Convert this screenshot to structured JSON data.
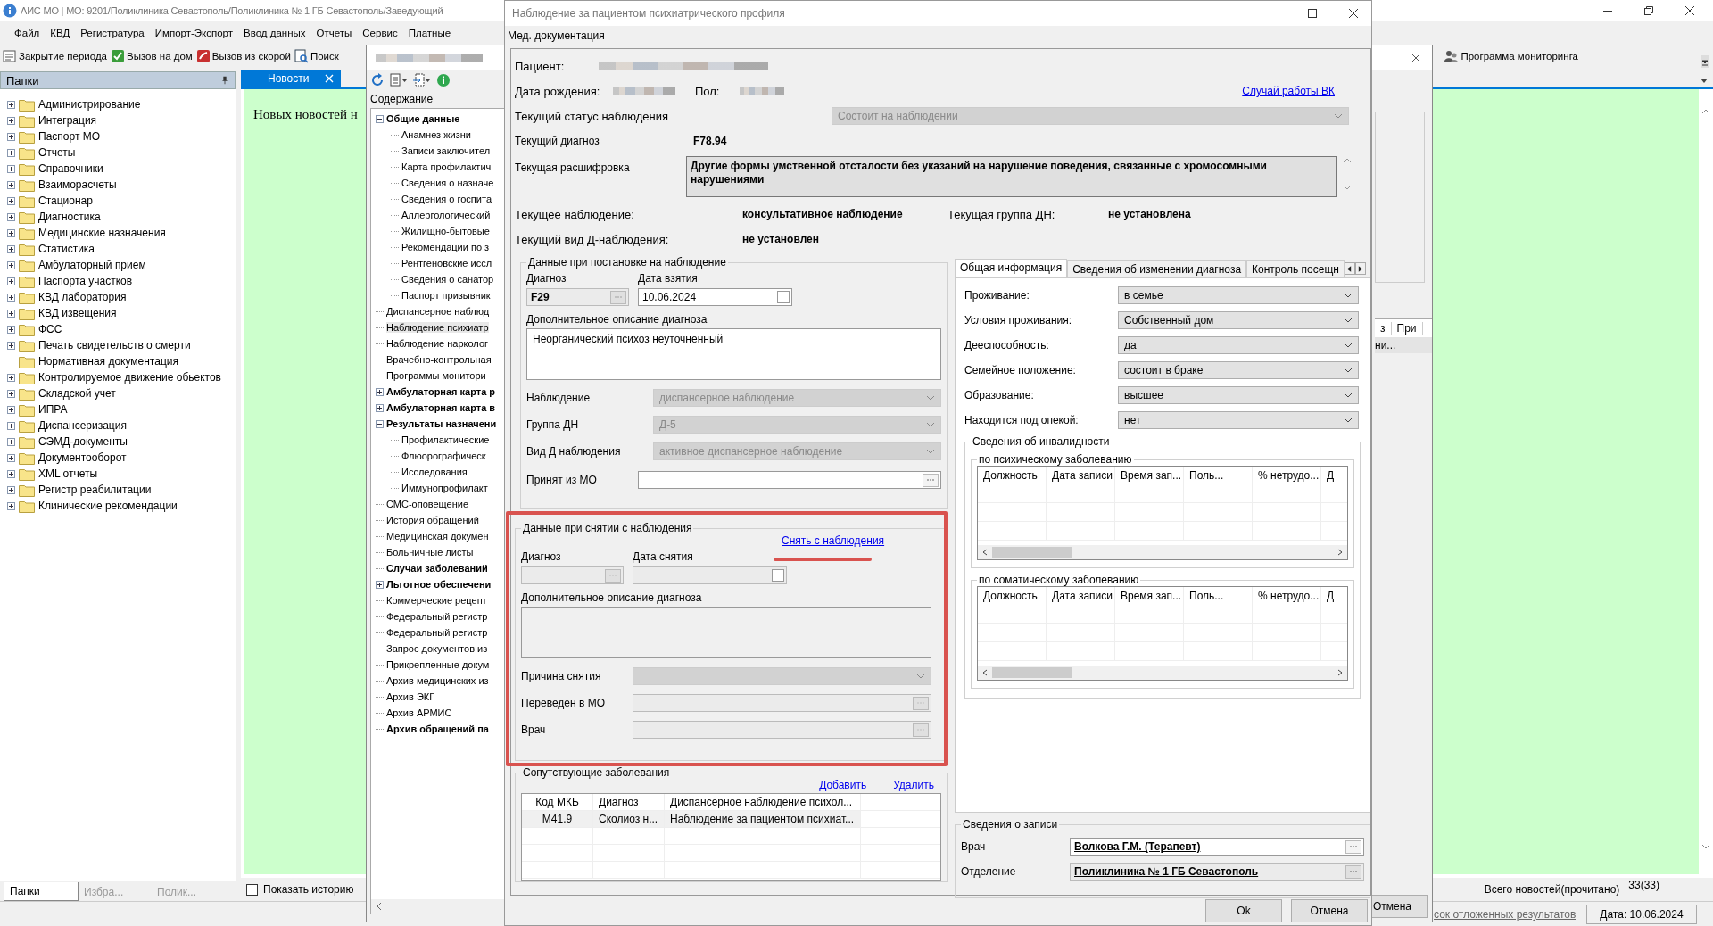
{
  "app": {
    "title": "АИС МО | МО: 9201/Поликлиника Севастополь/Поликлиника № 1 ГБ Севастополь/Заведующий",
    "menu": [
      "Файл",
      "КВД",
      "Регистратура",
      "Импорт-Экспорт",
      "Ввод данных",
      "Отчеты",
      "Сервис",
      "Платные"
    ],
    "toolbar": [
      {
        "label": "Закрытие периода",
        "kind": "period"
      },
      {
        "label": "Вызов на дом",
        "kind": "home"
      },
      {
        "label": "Вызов из скорой",
        "kind": "ambulance"
      },
      {
        "label": "Поиск",
        "kind": "search"
      }
    ],
    "toolbar_right": "Программа мониторинга",
    "folders_title": "Папки",
    "folders": [
      {
        "label": "Администрирование",
        "expandable": true
      },
      {
        "label": "Интеграция",
        "expandable": true
      },
      {
        "label": "Паспорт МО",
        "expandable": true
      },
      {
        "label": "Отчеты",
        "expandable": true
      },
      {
        "label": "Справочники",
        "expandable": true
      },
      {
        "label": "Взаиморасчеты",
        "expandable": true
      },
      {
        "label": "Стационар",
        "expandable": true
      },
      {
        "label": "Диагностика",
        "expandable": true
      },
      {
        "label": "Медицинские назначения",
        "expandable": true
      },
      {
        "label": "Статистика",
        "expandable": true
      },
      {
        "label": "Амбулаторный прием",
        "expandable": true
      },
      {
        "label": "Паспорта участков",
        "expandable": true
      },
      {
        "label": "КВД лаборатория",
        "expandable": true
      },
      {
        "label": "КВД извещения",
        "expandable": true
      },
      {
        "label": "ФСС",
        "expandable": true
      },
      {
        "label": "Печать свидетельств о смерти",
        "expandable": true
      },
      {
        "label": "Нормативная документация",
        "expandable": false
      },
      {
        "label": "Контролируемое движение обьектов",
        "expandable": true
      },
      {
        "label": "Складской учет",
        "expandable": true
      },
      {
        "label": "ИПРА",
        "expandable": true
      },
      {
        "label": "Диспансеризация",
        "expandable": true
      },
      {
        "label": "СЭМД-документы",
        "expandable": true
      },
      {
        "label": "Документооборот",
        "expandable": true
      },
      {
        "label": "XML отчеты",
        "expandable": true
      },
      {
        "label": "Регистр реабилитации",
        "expandable": true
      },
      {
        "label": "Клинические рекомендации",
        "expandable": true
      }
    ],
    "panel_tabs": [
      {
        "label": "Папки",
        "selected": true
      },
      {
        "label": "Избра...",
        "selected": false
      },
      {
        "label": "Полик...",
        "selected": false
      }
    ],
    "news_tab": "Новости",
    "news_text": "Новых новостей н",
    "show_history": {
      "label": "Показать историю",
      "checked": false
    },
    "news_total": "Всего новостей(прочитано)",
    "news_count": "33(33)",
    "status_link": "сок отложенных результатов",
    "status_date": "Дата: 10.06.2024"
  },
  "record_window": {
    "contents_label": "Содержание",
    "tree": [
      {
        "label": "Общие данные",
        "bold": true,
        "selected": false,
        "expanded": true,
        "children": [
          {
            "label": "Анамнез жизни",
            "bold": false,
            "selected": false
          },
          {
            "label": "Записи заключител",
            "bold": false,
            "selected": false
          },
          {
            "label": "Карта профилактич",
            "bold": false,
            "selected": false
          },
          {
            "label": "Сведения о назначе",
            "bold": false,
            "selected": false
          },
          {
            "label": "Сведения о госпита",
            "bold": false,
            "selected": false
          },
          {
            "label": "Аллергологический",
            "bold": false,
            "selected": false
          },
          {
            "label": "Жилищно-бытовые",
            "bold": false,
            "selected": false
          },
          {
            "label": "Рекомендации по з",
            "bold": false,
            "selected": false
          },
          {
            "label": "Рентгеновские иссл",
            "bold": false,
            "selected": false
          },
          {
            "label": "Сведения о санатор",
            "bold": false,
            "selected": false
          },
          {
            "label": "Паспорт призывник",
            "bold": false,
            "selected": false
          }
        ]
      },
      {
        "label": "Диспансерное наблюд",
        "bold": false,
        "selected": false
      },
      {
        "label": "Наблюдение психиатр",
        "bold": false,
        "selected": true
      },
      {
        "label": "Наблюдение нарколог",
        "bold": false,
        "selected": false
      },
      {
        "label": "Врачебно-контрольная",
        "bold": false,
        "selected": false
      },
      {
        "label": "Программы монитори",
        "bold": false,
        "selected": false
      },
      {
        "label": "Амбулаторная карта р",
        "bold": true,
        "selected": false,
        "expanded": false
      },
      {
        "label": "Амбулаторная карта в",
        "bold": true,
        "selected": false,
        "expanded": false
      },
      {
        "label": "Результаты назначени",
        "bold": true,
        "selected": false,
        "expanded": true,
        "children": [
          {
            "label": "Профилактические",
            "bold": false,
            "selected": false
          },
          {
            "label": "Флюорографическ",
            "bold": false,
            "selected": false
          },
          {
            "label": "Исследования",
            "bold": false,
            "selected": false
          },
          {
            "label": "Иммунопрофилакт",
            "bold": false,
            "selected": false
          }
        ]
      },
      {
        "label": "СМС-оповещение",
        "bold": false,
        "selected": false
      },
      {
        "label": "История обращений",
        "bold": false,
        "selected": false
      },
      {
        "label": "Медицинская докумен",
        "bold": false,
        "selected": false
      },
      {
        "label": "Больничные листы",
        "bold": false,
        "selected": false
      },
      {
        "label": "Случаи заболеваний",
        "bold": true,
        "selected": false
      },
      {
        "label": "Льготное обеспечени",
        "bold": true,
        "selected": false,
        "expanded": false
      },
      {
        "label": "Коммерческие рецепт",
        "bold": false,
        "selected": false
      },
      {
        "label": "Федеральный регистр",
        "bold": false,
        "selected": false
      },
      {
        "label": "Федеральный регистр",
        "bold": false,
        "selected": false
      },
      {
        "label": "Запрос документов из",
        "bold": false,
        "selected": false
      },
      {
        "label": "Прикрепленные докум",
        "bold": false,
        "selected": false
      },
      {
        "label": "Архив медицинских из",
        "bold": false,
        "selected": false
      },
      {
        "label": "Архив ЭКГ",
        "bold": false,
        "selected": false
      },
      {
        "label": "Архив АРМИС",
        "bold": false,
        "selected": false
      },
      {
        "label": "Архив обращений па",
        "bold": true,
        "selected": false
      }
    ],
    "grid_columns": [
      "з",
      "При"
    ],
    "grid_cell": "ни...",
    "cancel_button": "Отмена"
  },
  "dialog": {
    "title": "Наблюдение за пациентом психиатрического профиля",
    "menu": [
      "Мед. документация"
    ],
    "patient_label": "Пациент:",
    "birth_label": "Дата рождения:",
    "sex_label": "Пол:",
    "vk_link": "Случай работы ВК",
    "status": {
      "label": "Текущий статус наблюдения",
      "value": "Состоит на наблюдении",
      "disabled": true
    },
    "diagnosis": {
      "label": "Текущий диагноз",
      "value": "F78.94"
    },
    "decoding": {
      "label": "Текущая расшифровка",
      "value": "Другие формы умственной отсталости без указаний на нарушение поведения, связанные с хромосомными нарушениями"
    },
    "observation": {
      "label": "Текущее наблюдение:",
      "value": "консультативное наблюдение"
    },
    "group": {
      "label": "Текущая группа ДН:",
      "value": "не установлена"
    },
    "obs_kind": {
      "label": "Текущий вид Д-наблюдения:",
      "value": "не установлен"
    },
    "registration": {
      "title": "Данные при постановке на наблюдение",
      "diagnosis": {
        "label": "Диагноз",
        "value": "F29"
      },
      "date": {
        "label": "Дата взятия",
        "value": "10.06.2024",
        "checked": false
      },
      "description": {
        "label": "Дополнительное описание диагноза",
        "value": "Неорганический психоз неуточненный"
      },
      "fields": [
        {
          "label": "Наблюдение",
          "value": "диспансерное наблюдение",
          "kind": "combo",
          "disabled": true
        },
        {
          "label": "Группа ДН",
          "value": "Д-5",
          "kind": "combo",
          "disabled": true
        },
        {
          "label": "Вид Д наблюдения",
          "value": "активное диспансерное наблюдение",
          "kind": "combo",
          "disabled": true
        },
        {
          "label": "Принят из МО",
          "kind": "lookup",
          "disabled": false
        }
      ]
    },
    "removal": {
      "title": "Данные при снятии с наблюдения",
      "link": "Снять с наблюдения",
      "diagnosis_label": "Диагноз",
      "date_label": "Дата снятия",
      "date_checked": false,
      "description_label": "Дополнительное описание диагноза",
      "fields": [
        {
          "label": "Причина снятия",
          "kind": "combo",
          "disabled": true
        },
        {
          "label": "Переведен в МО",
          "kind": "lookup",
          "disabled": true
        },
        {
          "label": "Врач",
          "kind": "lookup",
          "disabled": true
        }
      ]
    },
    "comorbid": {
      "title": "Сопутствующие заболевания",
      "links": [
        "Добавить",
        "Удалить"
      ],
      "columns": [
        "Код МКБ",
        "Диагноз",
        "Диспансерное наблюдение психол..."
      ],
      "rows": [
        [
          "M41.9",
          "Сколиоз н...",
          "Наблюдение за пациентом психиат..."
        ]
      ]
    },
    "tabs": [
      {
        "label": "Общая информация",
        "selected": true
      },
      {
        "label": "Сведения об изменении диагноза",
        "selected": false
      },
      {
        "label": "Контроль посещн",
        "selected": false
      }
    ],
    "general_fields": [
      {
        "label": "Проживание:",
        "value": "в семье"
      },
      {
        "label": "Условия проживания:",
        "value": "Собственный дом"
      },
      {
        "label": "Дееспособность:",
        "value": "да"
      },
      {
        "label": "Семейное положение:",
        "value": "состоит в браке"
      },
      {
        "label": "Образование:",
        "value": "высшее"
      },
      {
        "label": "Находится под опекой:",
        "value": "нет"
      }
    ],
    "disability": {
      "title": "Сведения об инвалидности",
      "groups": [
        {
          "title": "по психическому заболеванию",
          "columns": [
            "Должность",
            "Дата записи",
            "Время зап...",
            "Поль...",
            "% нетрудо...",
            "Д"
          ]
        },
        {
          "title": "по соматическому заболеванию",
          "columns": [
            "Должность",
            "Дата записи",
            "Время зап...",
            "Поль...",
            "% нетрудо...",
            "Д"
          ]
        }
      ]
    },
    "record": {
      "title": "Сведения о записи",
      "fields": [
        {
          "label": "Врач",
          "value": "Волкова Г.М. (Терапевт)",
          "disabled": false
        },
        {
          "label": "Отделение",
          "value": "Поликлиника № 1 ГБ Севастополь",
          "disabled": true
        }
      ]
    },
    "buttons": [
      "Ok",
      "Отмена"
    ]
  }
}
